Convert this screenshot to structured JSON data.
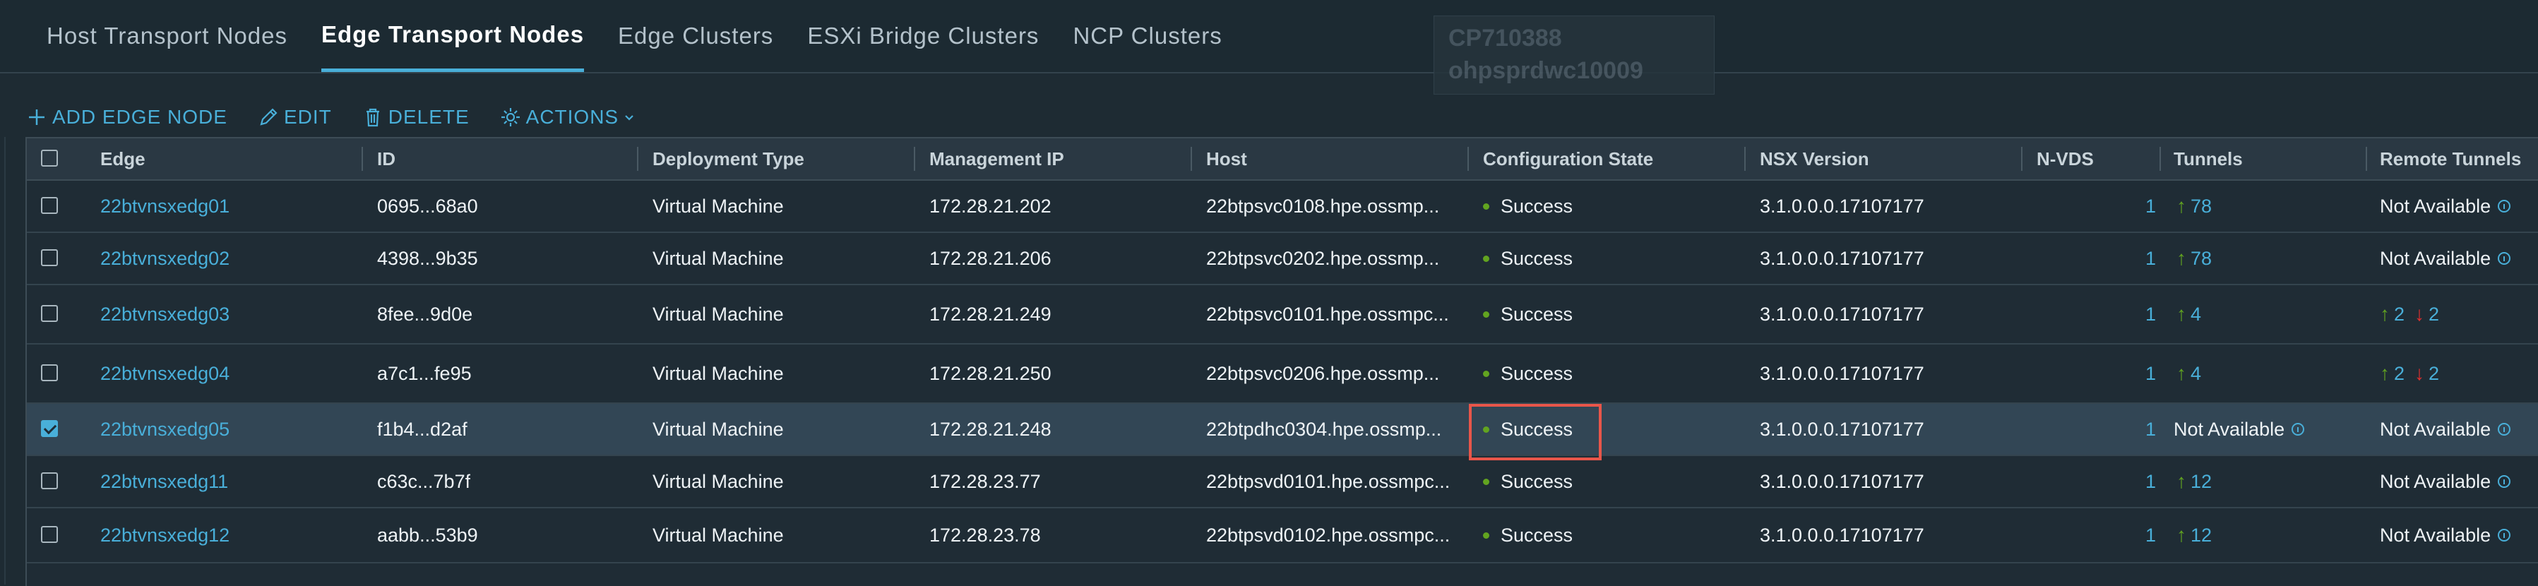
{
  "tabs": [
    {
      "label": "Host Transport Nodes",
      "active": false
    },
    {
      "label": "Edge Transport Nodes",
      "active": true
    },
    {
      "label": "Edge Clusters",
      "active": false
    },
    {
      "label": "ESXi Bridge Clusters",
      "active": false
    },
    {
      "label": "NCP Clusters",
      "active": false
    }
  ],
  "overlay": {
    "line1": "CP710388",
    "line2": "ohpsprdwc10009"
  },
  "toolbar": {
    "add_label": "ADD EDGE NODE",
    "edit_label": "EDIT",
    "delete_label": "DELETE",
    "actions_label": "ACTIONS"
  },
  "columns": {
    "edge": "Edge",
    "id": "ID",
    "deployment_type": "Deployment Type",
    "management_ip": "Management IP",
    "host": "Host",
    "configuration_state": "Configuration State",
    "nsx_version": "NSX Version",
    "nvds": "N-VDS",
    "tunnels": "Tunnels",
    "remote_tunnels": "Remote Tunnels"
  },
  "rows": [
    {
      "edge": "22btvnsxedg01",
      "id": "0695...68a0",
      "deployment_type": "Virtual Machine",
      "management_ip": "172.28.21.202",
      "host": "22btpsvc0108.hpe.ossmp...",
      "configuration_state": "Success",
      "nsx_version": "3.1.0.0.0.17107177",
      "nvds": "1",
      "tunnels": "78",
      "remote_tunnels": "Not Available",
      "remote_up": "",
      "remote_down": "",
      "selected": false
    },
    {
      "edge": "22btvnsxedg02",
      "id": "4398...9b35",
      "deployment_type": "Virtual Machine",
      "management_ip": "172.28.21.206",
      "host": "22btpsvc0202.hpe.ossmp...",
      "configuration_state": "Success",
      "nsx_version": "3.1.0.0.0.17107177",
      "nvds": "1",
      "tunnels": "78",
      "remote_tunnels": "Not Available",
      "remote_up": "",
      "remote_down": "",
      "selected": false
    },
    {
      "edge": "22btvnsxedg03",
      "id": "8fee...9d0e",
      "deployment_type": "Virtual Machine",
      "management_ip": "172.28.21.249",
      "host": "22btpsvc0101.hpe.ossmpc...",
      "configuration_state": "Success",
      "nsx_version": "3.1.0.0.0.17107177",
      "nvds": "1",
      "tunnels": "4",
      "remote_tunnels": "",
      "remote_up": "2",
      "remote_down": "2",
      "selected": false
    },
    {
      "edge": "22btvnsxedg04",
      "id": "a7c1...fe95",
      "deployment_type": "Virtual Machine",
      "management_ip": "172.28.21.250",
      "host": "22btpsvc0206.hpe.ossmp...",
      "configuration_state": "Success",
      "nsx_version": "3.1.0.0.0.17107177",
      "nvds": "1",
      "tunnels": "4",
      "remote_tunnels": "",
      "remote_up": "2",
      "remote_down": "2",
      "selected": false
    },
    {
      "edge": "22btvnsxedg05",
      "id": "f1b4...d2af",
      "deployment_type": "Virtual Machine",
      "management_ip": "172.28.21.248",
      "host": "22btpdhc0304.hpe.ossmp...",
      "configuration_state": "Success",
      "nsx_version": "3.1.0.0.0.17107177",
      "nvds": "1",
      "tunnels": "Not Available",
      "remote_tunnels": "Not Available",
      "remote_up": "",
      "remote_down": "",
      "selected": true
    },
    {
      "edge": "22btvnsxedg11",
      "id": "c63c...7b7f",
      "deployment_type": "Virtual Machine",
      "management_ip": "172.28.23.77",
      "host": "22btpsvd0101.hpe.ossmpc...",
      "configuration_state": "Success",
      "nsx_version": "3.1.0.0.0.17107177",
      "nvds": "1",
      "tunnels": "12",
      "remote_tunnels": "Not Available",
      "remote_up": "",
      "remote_down": "",
      "selected": false
    },
    {
      "edge": "22btvnsxedg12",
      "id": "aabb...53b9",
      "deployment_type": "Virtual Machine",
      "management_ip": "172.28.23.78",
      "host": "22btpsvd0102.hpe.ossmpc...",
      "configuration_state": "Success",
      "nsx_version": "3.1.0.0.0.17107177",
      "nvds": "1",
      "tunnels": "12",
      "remote_tunnels": "Not Available",
      "remote_up": "",
      "remote_down": "",
      "selected": false
    }
  ],
  "colors": {
    "accent": "#49afd9",
    "success": "#62a420",
    "down": "#e02e2e",
    "highlight": "#e8564a"
  }
}
